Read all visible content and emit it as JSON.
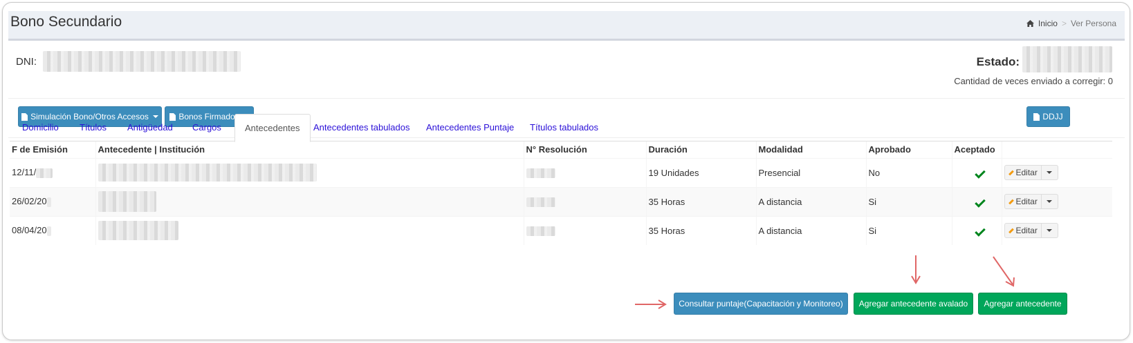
{
  "header": {
    "title": "Bono Secundario",
    "breadcrumb": {
      "home": "Inicio",
      "separator": ">",
      "current": "Ver Persona"
    }
  },
  "person": {
    "dni_label": "DNI:",
    "dni_value_redacted": "-",
    "estado_label": "Estado:",
    "corregir_text": "Cantidad de veces enviado a corregir: 0"
  },
  "toolbar": {
    "simulacion_label": "Simulación Bono/Otros Accesos",
    "bonos_label": "Bonos Firmados",
    "ddjj_label": "DDJJ"
  },
  "tabs": [
    {
      "label": "Domicilio",
      "active": false
    },
    {
      "label": "Títulos",
      "active": false
    },
    {
      "label": "Antigüedad",
      "active": false
    },
    {
      "label": "Cargos",
      "active": false
    },
    {
      "label": "Antecedentes",
      "active": true
    },
    {
      "label": "Antecedentes tabulados",
      "active": false
    },
    {
      "label": "Antecedentes Puntaje",
      "active": false
    },
    {
      "label": "Títulos tabulados",
      "active": false
    }
  ],
  "table": {
    "columns": [
      "F de Emisión",
      "Antecedente | Institución",
      "N° Resolución",
      "Duración",
      "Modalidad",
      "Aprobado",
      "Aceptado",
      ""
    ],
    "rows": [
      {
        "fecha": "12/11/",
        "duracion": "19 Unidades",
        "modalidad": "Presencial",
        "aprobado": "No",
        "aceptado": true,
        "edit_label": "Editar"
      },
      {
        "fecha": "26/02/20",
        "duracion": "35 Horas",
        "modalidad": "A distancia",
        "aprobado": "Si",
        "aceptado": true,
        "edit_label": "Editar"
      },
      {
        "fecha": "08/04/20",
        "duracion": "35 Horas",
        "modalidad": "A distancia",
        "aprobado": "Si",
        "aceptado": true,
        "edit_label": "Editar"
      }
    ]
  },
  "actions": {
    "consultar_label": "Consultar puntaje(Capacitación y Monitoreo)",
    "agregar_avalado_label": "Agregar antecedente avalado",
    "agregar_label": "Agregar antecedente"
  },
  "colors": {
    "primary": "#3c8dbc",
    "success": "#00a65a",
    "tab_link": "#2b10d8",
    "annotation_arrow": "#e06666"
  }
}
